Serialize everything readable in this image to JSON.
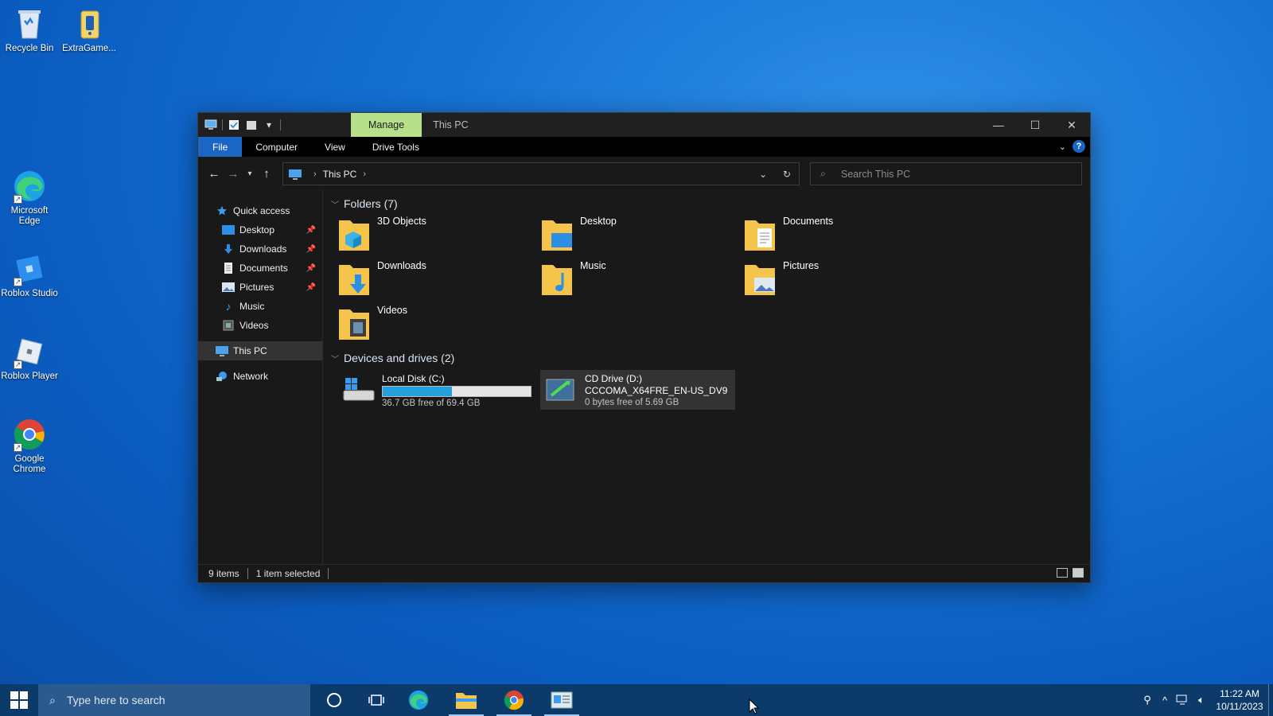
{
  "desktop": {
    "icons": [
      {
        "label": "Recycle Bin",
        "icon": "recycle-bin-icon"
      },
      {
        "label": "ExtraGame...",
        "icon": "extragame-icon"
      },
      {
        "label": "Microsoft Edge",
        "icon": "edge-icon"
      },
      {
        "label": "Roblox Studio",
        "icon": "roblox-studio-icon"
      },
      {
        "label": "Roblox Player",
        "icon": "roblox-player-icon"
      },
      {
        "label": "Google Chrome",
        "icon": "chrome-icon"
      }
    ]
  },
  "window": {
    "manage_tab": "Manage",
    "title": "This PC",
    "ribbon_tabs": [
      "File",
      "Computer",
      "View",
      "Drive Tools"
    ],
    "address": {
      "path": "This PC"
    },
    "search_placeholder": "Search This PC",
    "nav_pane": {
      "quick_access": "Quick access",
      "items": [
        {
          "label": "Desktop",
          "pinned": true
        },
        {
          "label": "Downloads",
          "pinned": true
        },
        {
          "label": "Documents",
          "pinned": true
        },
        {
          "label": "Pictures",
          "pinned": true
        },
        {
          "label": "Music",
          "pinned": false
        },
        {
          "label": "Videos",
          "pinned": false
        }
      ],
      "this_pc": "This PC",
      "network": "Network"
    },
    "folders_header": "Folders (7)",
    "folders": [
      "3D Objects",
      "Desktop",
      "Documents",
      "Downloads",
      "Music",
      "Pictures",
      "Videos"
    ],
    "drives_header": "Devices and drives (2)",
    "drives": [
      {
        "name": "Local Disk (C:)",
        "free": "36.7 GB free of 69.4 GB",
        "used_fraction": 0.47
      },
      {
        "name": "CD Drive (D:)",
        "label": "CCCOMA_X64FRE_EN-US_DV9",
        "free": "0 bytes free of 5.69 GB"
      }
    ],
    "status": {
      "items": "9 items",
      "selected": "1 item selected"
    }
  },
  "taskbar": {
    "search_placeholder": "Type here to search",
    "time": "11:22 AM",
    "date": "10/11/2023"
  },
  "colors": {
    "manage_tab": "#b7e08a",
    "file_tab": "#1b66c4",
    "drive_bar": "#26a0da"
  }
}
